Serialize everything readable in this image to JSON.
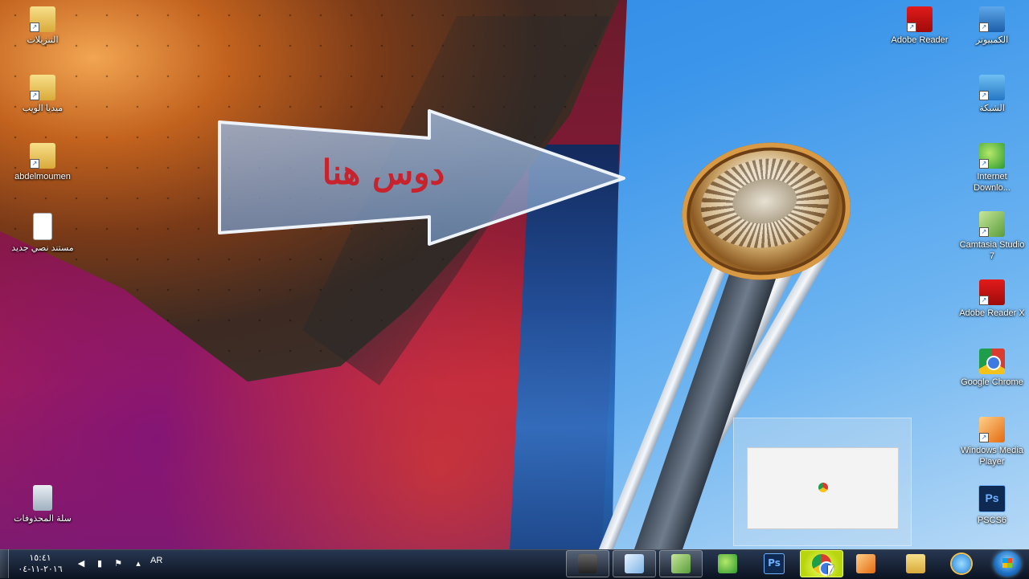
{
  "overlay": {
    "arrow_text": "دوس هنا"
  },
  "desktop_icons_left": [
    {
      "label": "التنزيلات",
      "icon": "downloads-folder-icon"
    },
    {
      "label": "ميديا الويب",
      "icon": "folder-icon"
    },
    {
      "label": "abdelmoumen",
      "icon": "user-folder-icon"
    },
    {
      "label": "مستند نصي جديد",
      "icon": "text-document-icon"
    },
    {
      "label": "سلة المحذوفات",
      "icon": "recycle-bin-icon"
    }
  ],
  "desktop_icons_right": [
    {
      "label": "الكمبيوتر",
      "icon": "computer-icon"
    },
    {
      "label": "Adobe Reader",
      "icon": "pdf-icon"
    },
    {
      "label": "الشبكة",
      "icon": "network-icon"
    },
    {
      "label": "Internet Downlo...",
      "icon": "idm-icon"
    },
    {
      "label": "Camtasia Studio 7",
      "icon": "camtasia-icon"
    },
    {
      "label": "Adobe Reader X",
      "icon": "pdf-icon"
    },
    {
      "label": "Google Chrome",
      "icon": "chrome-icon"
    },
    {
      "label": "Windows Media Player",
      "icon": "media-player-icon"
    },
    {
      "label": "PSCS6",
      "icon": "photoshop-icon"
    }
  ],
  "taskbar": {
    "pinned": [
      {
        "name": "windows-explorer",
        "icon": "folder-icon"
      },
      {
        "name": "internet-explorer",
        "icon": "ie-icon"
      },
      {
        "name": "media-player",
        "icon": "media-player-icon"
      },
      {
        "name": "google-chrome",
        "icon": "chrome-icon",
        "highlighted": true
      },
      {
        "name": "photoshop",
        "icon": "photoshop-icon",
        "label": "Ps"
      },
      {
        "name": "internet-download-manager",
        "icon": "idm-icon"
      },
      {
        "name": "camtasia-studio",
        "icon": "camtasia-icon"
      },
      {
        "name": "text-document",
        "icon": "notepad-icon"
      },
      {
        "name": "camtasia-recorder",
        "icon": "recorder-icon"
      }
    ],
    "tray": {
      "language": "AR",
      "time": "١٥:٤١",
      "date": "٢٠١٦-١١-٠٤"
    }
  },
  "colors": {
    "arrow_text": "#c8232c",
    "taskbar": "#141b27",
    "highlight": "#d4ee1a"
  }
}
